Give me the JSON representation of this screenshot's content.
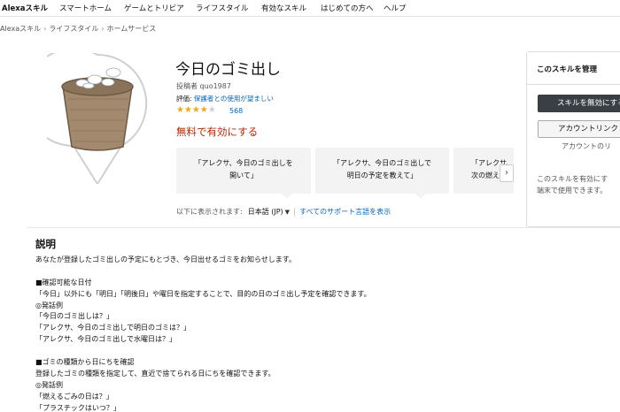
{
  "topnav": {
    "items": [
      "Alexaスキル",
      "スマートホーム",
      "ゲームとトリビア",
      "ライフスタイル",
      "有効なスキル",
      "はじめての方へ",
      "ヘルプ"
    ]
  },
  "breadcrumb": [
    "Alexaスキル",
    "ライフスタイル",
    "ホームサービス"
  ],
  "skill": {
    "title": "今日のゴミ出し",
    "author": "投稿者 quo1987",
    "rating_label": "評価:",
    "rating_value": "保護者との使用が望ましい",
    "stars": 4,
    "stars_text_full": "★★★★",
    "stars_text_empty": "★",
    "review_count": "568",
    "free_enable": "無料で有効にする"
  },
  "utterances": [
    {
      "line1": "「アレクサ、今日のゴミ出しを",
      "line2": "開いて」"
    },
    {
      "line1": "「アレクサ、今日のゴミ出しで",
      "line2": "明日の予定を教えて」"
    },
    {
      "line1": "「アレクサ、",
      "line2": "次の燃え"
    }
  ],
  "carousel": {
    "next_glyph": "›"
  },
  "language": {
    "label": "以下に表示されます:",
    "selected": "日本語 (JP)",
    "arrow": "▼",
    "all_link": "すべてのサポート言語を表示"
  },
  "manage": {
    "title": "このスキルを管理",
    "primary_button": "スキルを無効にする",
    "secondary_button": "アカウントリンク",
    "note": "アカウントのリ",
    "desc_line1": "このスキルを有効にす",
    "desc_line2": "端末で使用できます。"
  },
  "description": {
    "heading": "説明",
    "lines": [
      "あなたが登録したゴミ出しの予定にもとづき、今日出せるゴミをお知らせします。",
      "",
      "■確認可能な日付",
      "「今日」以外にも「明日」「明後日」や曜日を指定することで、目的の日のゴミ出し予定を確認できます。",
      "◎発話例",
      "「今日のゴミ出しは？」",
      "「アレクサ、今日のゴミ出しで明日のゴミは？」",
      "「アレクサ、今日のゴミ出しで水曜日は？」",
      "",
      "■ゴミの種類から日にちを確認",
      "登録したゴミの種類を指定して、直近で捨てられる日にちを確認できます。",
      "◎発話例",
      "「燃えるごみの日は？」",
      "「プラスチックはいつ？」"
    ]
  },
  "colors": {
    "link": "#0066c0",
    "price": "#b12704",
    "star": "#f0a81e",
    "button_dark": "#3a3f44"
  }
}
